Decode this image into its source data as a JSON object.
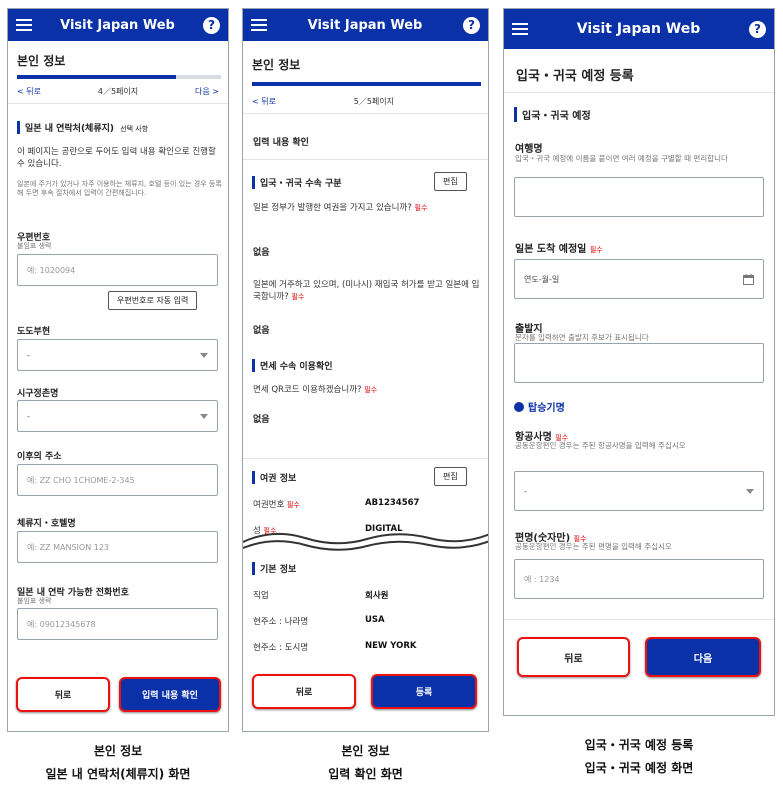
{
  "app_title": "Visit Japan Web",
  "help_glyph": "?",
  "screen1": {
    "header": "본인 정보",
    "progress": 0.78,
    "back_link": "< 뒤로",
    "page_indicator": "4／5페이지",
    "next_link": "다음 >",
    "section_title": "일본 내 연락처(체류지)",
    "section_optional": "선택 사항",
    "intro": "이 페이지는 공란으로 두어도 입력 내용 확인으로 진행할 수 있습니다.",
    "note": "일본에 주거가 있거나 자주 이용하는 체류지, 호텔 등이 있는 경우 등록해 두면 후속 절차에서 입력이 간편해집니다.",
    "postal_label": "우편번호",
    "postal_hint": "불임표 생략",
    "postal_placeholder": "예: 1020094",
    "postal_autofill_button": "우편번호로 자동 입력",
    "prefecture_label": "도도부현",
    "prefecture_value": "-",
    "city_label": "시구정촌명",
    "city_value": "-",
    "address_label": "이후의 주소",
    "address_placeholder": "예: ZZ CHO 1CHOME-2-345",
    "hotel_label": "체류지・호텔명",
    "hotel_placeholder": "예: ZZ MANSION 123",
    "phone_label": "일본 내 연락 가능한 전화번호",
    "phone_hint": "불임표 생략",
    "phone_placeholder": "예: 09012345678",
    "back_button": "뒤로",
    "confirm_button": "입력 내용 확인"
  },
  "screen2": {
    "header": "본인 정보",
    "progress": 1.0,
    "back_link": "< 뒤로",
    "page_indicator": "5／5페이지",
    "confirm_title": "입력 내용 확인",
    "section1_title": "입국・귀국 수속 구분",
    "edit_label": "편집",
    "q1": "일본 정부가 발행한 여권을 가지고 있습니까?",
    "q1_req": "필수",
    "a1": "없음",
    "q2": "일본에 거주하고 있으며, (미나시) 재입국 허가를 받고 일본에 입국합니까?",
    "q2_req": "필수",
    "a2": "없음",
    "section2_title": "면세 수속 이용확인",
    "q3": "면세 QR코드 이용하겠습니까?",
    "q3_req": "필수",
    "a3": "없음",
    "passport_title": "여권 정보",
    "passport_edit_label": "편집",
    "passport_no_label": "여권번호",
    "passport_no_req": "필수",
    "passport_no_value": "AB1234567",
    "surname_label": "성",
    "surname_req": "필수",
    "surname_value": "DIGITAL",
    "basic_title": "기본 정보",
    "occupation_label": "직업",
    "occupation_value": "회사원",
    "country_label": "현주소 : 나라명",
    "country_value": "USA",
    "cityres_label": "현주소 : 도시명",
    "cityres_value": "NEW YORK",
    "back_button": "뒤로",
    "register_button": "등록"
  },
  "screen3": {
    "header": "입국・귀국 예정 등록",
    "section_title": "입국・귀국 예정",
    "trip_label": "여행명",
    "trip_help": "입국・귀국 예정에 이름을 붙이면 여러 예정을 구별할 때 편리합니다",
    "arrival_label": "일본 도착 예정일",
    "arrival_req": "필수",
    "arrival_placeholder": "연도-월-일",
    "origin_label": "출발지",
    "origin_help": "문자를 입력하면 출발지 후보가 표시됩니다",
    "flight_section": "탑승기명",
    "airline_label": "항공사명",
    "airline_req": "필수",
    "airline_help": "공동운항편인 경우는 주된 항공사명을 입력해 주십시오",
    "airline_value": "-",
    "flightno_label": "편명(숫자만)",
    "flightno_req": "필수",
    "flightno_help": "공동운항편인 경우는 주된 편명을 입력해 주십시오",
    "flightno_placeholder": "예 : 1234",
    "back_button": "뒤로",
    "next_button": "다음"
  },
  "captions": {
    "c1_line1": "본인 정보",
    "c1_line2": "일본 내 연락처(체류지) 화면",
    "c2_line1": "본인 정보",
    "c2_line2": "입력 확인 화면",
    "c3_line1": "입국・귀국 예정 등록",
    "c3_line2": "입국・귀국 예정 화면"
  }
}
